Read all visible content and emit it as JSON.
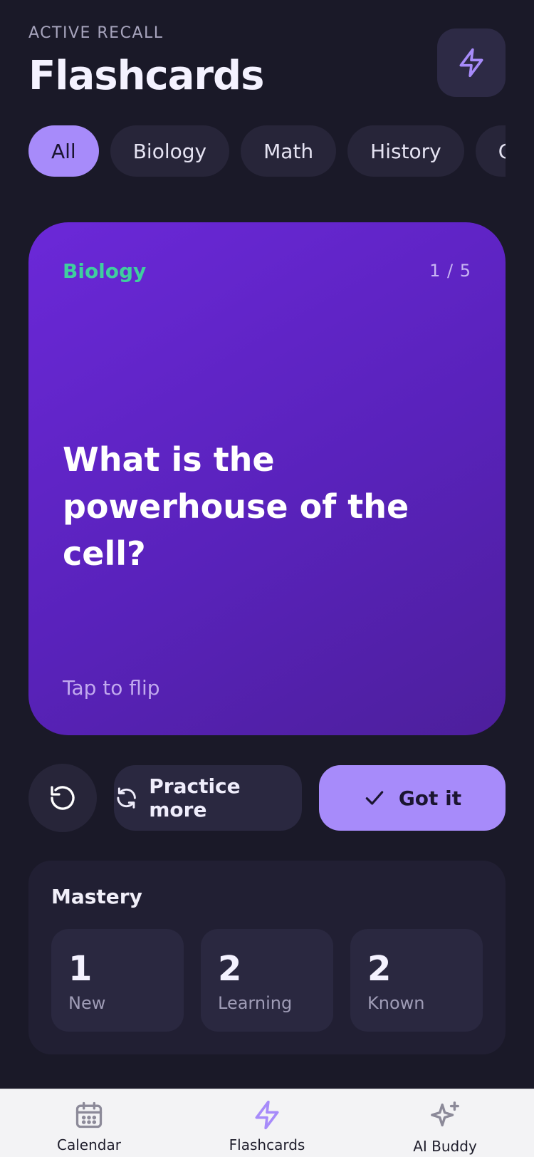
{
  "header": {
    "eyebrow": "ACTIVE RECALL",
    "title": "Flashcards",
    "action_icon": "bolt-icon"
  },
  "categories": [
    {
      "label": "All",
      "active": true
    },
    {
      "label": "Biology",
      "active": false
    },
    {
      "label": "Math",
      "active": false
    },
    {
      "label": "History",
      "active": false
    },
    {
      "label": "Chemistry",
      "active": false
    }
  ],
  "card": {
    "category": "Biology",
    "counter": "1 / 5",
    "question": "What is the powerhouse of the cell?",
    "hint": "Tap to flip"
  },
  "actions": {
    "reset_icon": "rotate-ccw-icon",
    "practice_label": "Practice more",
    "practice_icon": "refresh-icon",
    "got_label": "Got it",
    "got_icon": "check-icon"
  },
  "mastery": {
    "title": "Mastery",
    "stats": [
      {
        "value": "1",
        "label": "New"
      },
      {
        "value": "2",
        "label": "Learning"
      },
      {
        "value": "2",
        "label": "Known"
      }
    ]
  },
  "nav": {
    "items": [
      {
        "label": "Calendar",
        "icon": "calendar-icon",
        "active": false
      },
      {
        "label": "Flashcards",
        "icon": "bolt-icon",
        "active": true
      },
      {
        "label": "AI Buddy",
        "icon": "sparkles-icon",
        "active": false
      }
    ]
  },
  "colors": {
    "background": "#1a1928",
    "accent": "#a78bfa",
    "card": "#5922bb",
    "category_text": "#3fcf9e"
  }
}
